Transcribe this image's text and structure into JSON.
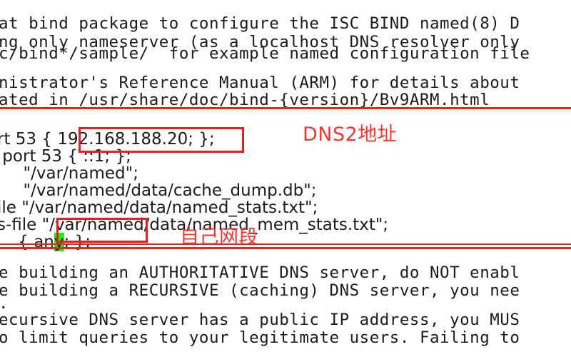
{
  "window": {
    "kind": "terminal-text-editor",
    "content_type": "BIND named.conf configuration",
    "background_color": "#ffffff",
    "text_color": "#1c1c1c",
    "annotation_color": "#ee1d1d",
    "cursor_highlight_color": "#18f018"
  },
  "top_block": {
    "lines": [
      "at bind package to configure the ISC BIND named(8) D",
      "ng only nameserver (as a localhost DNS resolver only",
      "",
      "c/bind*/sample/  for example named configuration file",
      "",
      "nistrator's Reference Manual (ARM) for details about",
      "ated in /usr/share/doc/bind-{version}/Bv9ARM.html"
    ]
  },
  "mid_block": {
    "lines": [
      {
        "before": "rt 53 { ",
        "boxed": "192.168.188.20",
        "after": "; };"
      },
      {
        "plain": " port 53 { ::1; };"
      },
      {
        "plain": "     \"/var/named\";"
      },
      {
        "plain": "     \"/var/named/data/cache_dump.db\";"
      },
      {
        "plain": "ile \"/var/named/data/named_stats.txt\";"
      },
      {
        "plain": "s-file \"/var/named/data/named_mem_stats.txt\";"
      },
      {
        "prefix": "    { ",
        "cursor_before": "an",
        "cursor_char": "y",
        "cursor_after": "; };"
      }
    ]
  },
  "bottom_block": {
    "lines": [
      "e building an AUTHORITATIVE DNS server, do NOT enabl",
      "e building a RECURSIVE (caching) DNS server, you nee",
      ".",
      "ecursive DNS server has a public IP address, you MUS",
      "o limit queries to your legitimate users. Failing to"
    ]
  },
  "annotations": [
    {
      "id": "dns2-address",
      "label": "DNS2地址",
      "target_value": "192.168.188.20",
      "label_color": "#f2372c"
    },
    {
      "id": "own-network-segment",
      "label": "自己网段",
      "target_value": "any",
      "label_color": "#f2372c"
    }
  ]
}
